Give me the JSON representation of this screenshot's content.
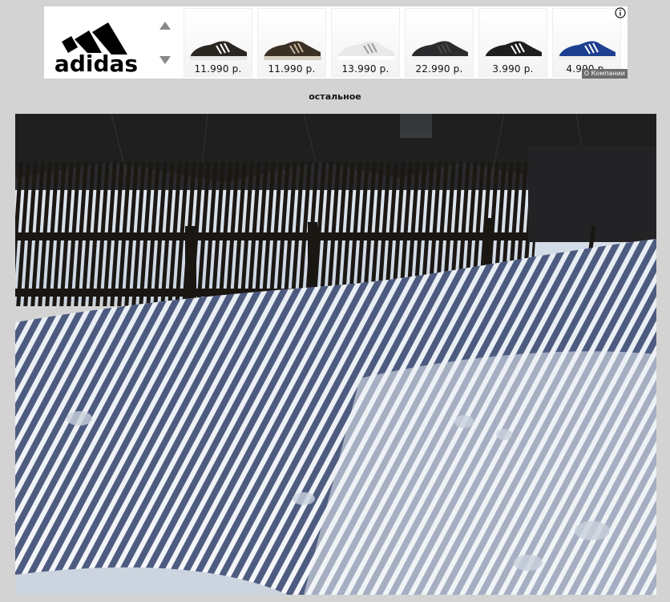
{
  "ad": {
    "brand": "adidas",
    "company_label": "О Компании",
    "products": [
      {
        "price": "11.990 р.",
        "shoe_color": "#2a2622",
        "sole_color": "#e8e8e8",
        "stripe_color": "#ffffff"
      },
      {
        "price": "11.990 р.",
        "shoe_color": "#3a3026",
        "sole_color": "#d9d2c2",
        "stripe_color": "#c9b89a"
      },
      {
        "price": "13.990 р.",
        "shoe_color": "#e9e9ea",
        "sole_color": "#ffffff",
        "stripe_color": "#9c9c9c"
      },
      {
        "price": "22.990 р.",
        "shoe_color": "#2b2b2d",
        "sole_color": "#f2f2f2",
        "stripe_color": "#4a4a4a"
      },
      {
        "price": "3.990 р.",
        "shoe_color": "#1e1e1e",
        "sole_color": "#f7f7f7",
        "stripe_color": "#ffffff"
      },
      {
        "price": "4.990 р.",
        "shoe_color": "#1c3f8f",
        "sole_color": "#f1f1f1",
        "stripe_color": "#ffffff"
      }
    ]
  },
  "section": {
    "title": "остальное"
  },
  "photo": {
    "subject": "snow-fence-shadows"
  },
  "colors": {
    "page_bg": "#d3d3d3",
    "banner_bg": "#ffffff",
    "company_tag_bg": "#6d6d6d"
  },
  "icons": {
    "up": "arrow-up-icon",
    "down": "arrow-down-icon",
    "info": "info-icon"
  }
}
